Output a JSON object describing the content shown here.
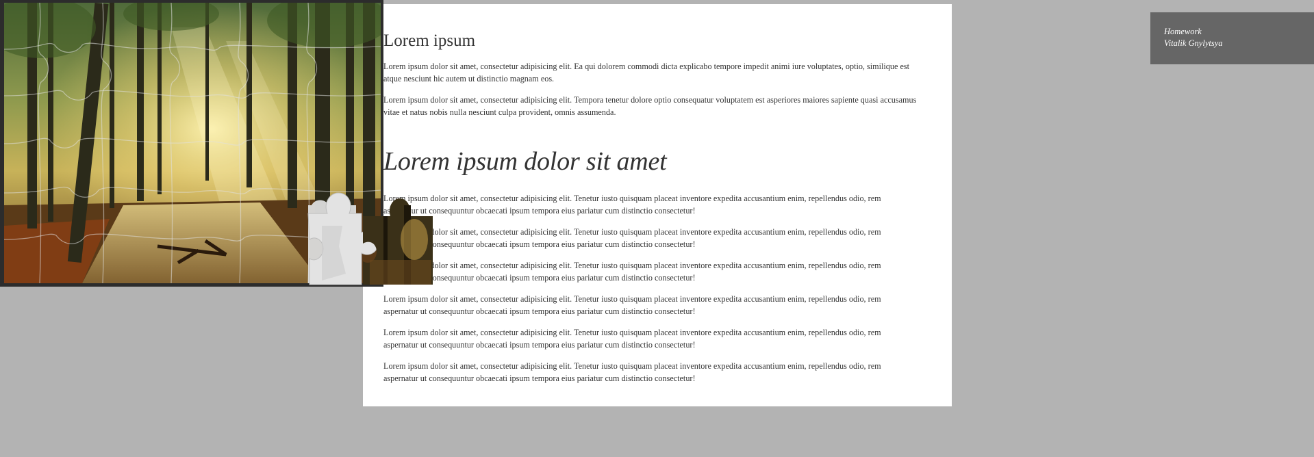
{
  "article": {
    "heading1": "Lorem ipsum",
    "para1": "Lorem ipsum dolor sit amet, consectetur adipisicing elit. Ea qui dolorem commodi dicta explicabo tempore impedit animi iure voluptates, optio, similique est atque nesciunt hic autem ut distinctio magnam eos.",
    "para2": "Lorem ipsum dolor sit amet, consectetur adipisicing elit. Tempora tenetur dolore optio consequatur voluptatem est asperiores maiores sapiente quasi accusamus vitae et natus nobis nulla nesciunt culpa provident, omnis assumenda.",
    "heading2": "Lorem ipsum dolor sit amet",
    "repeated_para": "Lorem ipsum dolor sit amet, consectetur adipisicing elit. Tenetur iusto quisquam placeat inventore expedita accusantium enim, repellendus odio, rem aspernatur ut consequuntur obcaecati ipsum tempora eius pariatur cum distinctio consectetur!"
  },
  "badge": {
    "line1": "Homework",
    "line2": "Vitalik Gnylytsya"
  },
  "puzzle": {
    "image": "sunlit-forest-path",
    "detached_pieces": 2
  },
  "colors": {
    "page_bg": "#b3b3b3",
    "card_bg": "#ffffff",
    "badge_bg": "#666666",
    "board_frame": "#2c2c2c"
  }
}
